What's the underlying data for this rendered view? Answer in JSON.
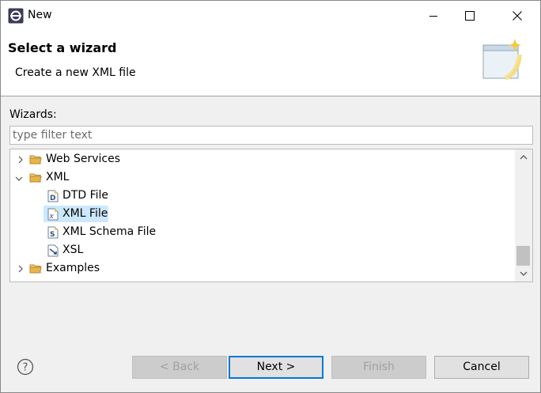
{
  "window": {
    "title": "New"
  },
  "banner": {
    "title": "Select a wizard",
    "description": "Create a new XML file"
  },
  "wizards": {
    "label": "Wizards:",
    "filter_placeholder": "type filter text",
    "filter_value": "",
    "tree": [
      {
        "label": "Web Services",
        "icon": "folder-icon",
        "expanded": false,
        "level": 0
      },
      {
        "label": "XML",
        "icon": "folder-icon",
        "expanded": true,
        "level": 0
      },
      {
        "label": "DTD File",
        "icon": "dtd-file-icon",
        "level": 1
      },
      {
        "label": "XML File",
        "icon": "xml-file-icon",
        "level": 1,
        "selected": true
      },
      {
        "label": "XML Schema File",
        "icon": "xml-schema-file-icon",
        "level": 1
      },
      {
        "label": "XSL",
        "icon": "xsl-file-icon",
        "level": 1
      },
      {
        "label": "Examples",
        "icon": "folder-icon",
        "expanded": false,
        "level": 0
      }
    ]
  },
  "buttons": {
    "back": "< Back",
    "next": "Next >",
    "finish": "Finish",
    "cancel": "Cancel"
  },
  "colors": {
    "selection": "#cce8ff",
    "default_button_border": "#0078d7",
    "folder": "#e8b54a"
  }
}
